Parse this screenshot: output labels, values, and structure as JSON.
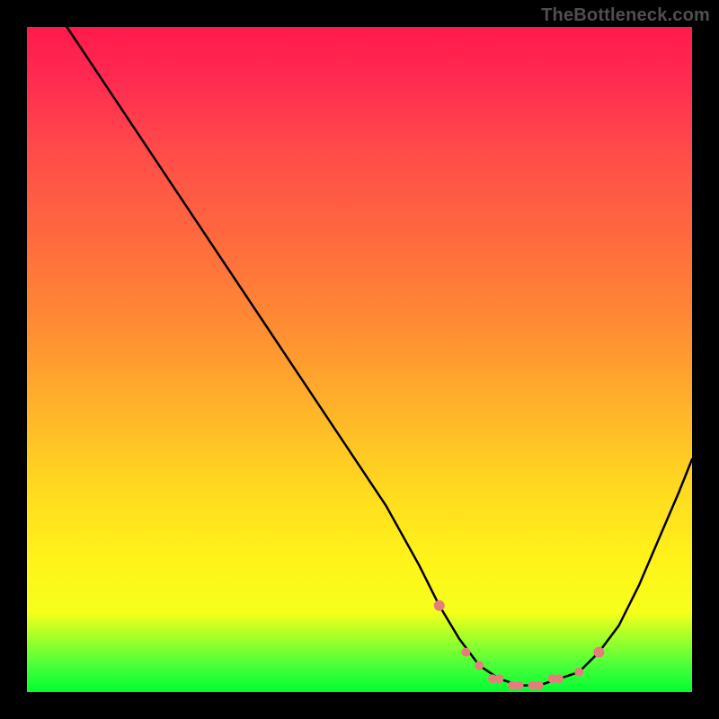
{
  "watermark": "TheBottleneck.com",
  "chart_data": {
    "type": "line",
    "title": "",
    "xlabel": "",
    "ylabel": "",
    "xlim": [
      0,
      100
    ],
    "ylim": [
      0,
      100
    ],
    "grid": false,
    "legend": false,
    "series": [
      {
        "name": "bottleneck-curve",
        "x": [
          6,
          12,
          18,
          24,
          30,
          36,
          42,
          48,
          54,
          59,
          62,
          65,
          68,
          71,
          74,
          77,
          80,
          83,
          86,
          89,
          92,
          95,
          98,
          100
        ],
        "values": [
          100,
          91,
          82,
          73,
          64,
          55,
          46,
          37,
          28,
          19,
          13,
          8,
          4,
          2,
          1,
          1,
          2,
          3,
          6,
          10,
          16,
          23,
          30,
          35
        ]
      }
    ],
    "markers": {
      "name": "highlight-dots",
      "color": "#e57d7c",
      "x": [
        62,
        66,
        68,
        70,
        71,
        73,
        74,
        76,
        77,
        79,
        80,
        83,
        86
      ],
      "values": [
        13,
        6,
        4,
        2,
        2,
        1,
        1,
        1,
        1,
        2,
        2,
        3,
        6
      ]
    },
    "gradient_colors": {
      "top": "#ff1a4d",
      "mid_upper": "#ff8c33",
      "mid_lower": "#fff31a",
      "bottom": "#00ff30"
    }
  }
}
